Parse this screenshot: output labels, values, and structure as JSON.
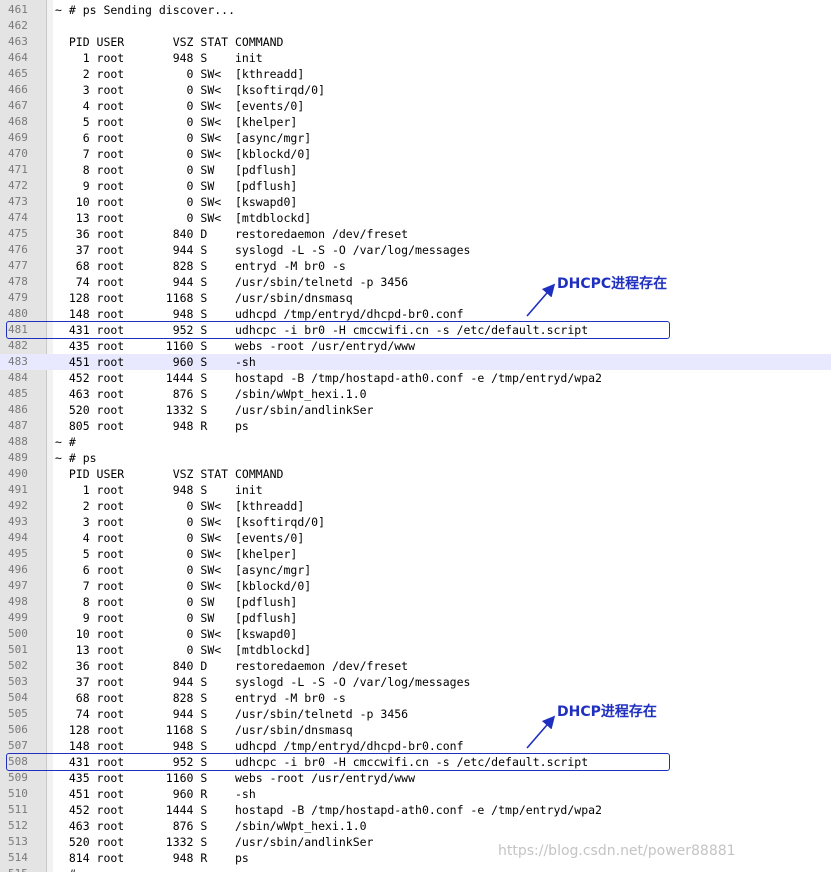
{
  "editor": {
    "lines": [
      {
        "n": "461",
        "text": "~ # ps Sending discover..."
      },
      {
        "n": "462",
        "text": ""
      },
      {
        "n": "463",
        "text": "  PID USER       VSZ STAT COMMAND"
      },
      {
        "n": "464",
        "text": "    1 root       948 S    init"
      },
      {
        "n": "465",
        "text": "    2 root         0 SW<  [kthreadd]"
      },
      {
        "n": "466",
        "text": "    3 root         0 SW<  [ksoftirqd/0]"
      },
      {
        "n": "467",
        "text": "    4 root         0 SW<  [events/0]"
      },
      {
        "n": "468",
        "text": "    5 root         0 SW<  [khelper]"
      },
      {
        "n": "469",
        "text": "    6 root         0 SW<  [async/mgr]"
      },
      {
        "n": "470",
        "text": "    7 root         0 SW<  [kblockd/0]"
      },
      {
        "n": "471",
        "text": "    8 root         0 SW   [pdflush]"
      },
      {
        "n": "472",
        "text": "    9 root         0 SW   [pdflush]"
      },
      {
        "n": "473",
        "text": "   10 root         0 SW<  [kswapd0]"
      },
      {
        "n": "474",
        "text": "   13 root         0 SW<  [mtdblockd]"
      },
      {
        "n": "475",
        "text": "   36 root       840 D    restoredaemon /dev/freset"
      },
      {
        "n": "476",
        "text": "   37 root       944 S    syslogd -L -S -O /var/log/messages"
      },
      {
        "n": "477",
        "text": "   68 root       828 S    entryd -M br0 -s"
      },
      {
        "n": "478",
        "text": "   74 root       944 S    /usr/sbin/telnetd -p 3456"
      },
      {
        "n": "479",
        "text": "  128 root      1168 S    /usr/sbin/dnsmasq"
      },
      {
        "n": "480",
        "text": "  148 root       948 S    udhcpd /tmp/entryd/dhcpd-br0.conf"
      },
      {
        "n": "481",
        "text": "  431 root       952 S    udhcpc -i br0 -H cmccwifi.cn -s /etc/default.script"
      },
      {
        "n": "482",
        "text": "  435 root      1160 S    webs -root /usr/entryd/www"
      },
      {
        "n": "483",
        "text": "  451 root       960 S    -sh"
      },
      {
        "n": "484",
        "text": "  452 root      1444 S    hostapd -B /tmp/hostapd-ath0.conf -e /tmp/entryd/wpa2"
      },
      {
        "n": "485",
        "text": "  463 root       876 S    /sbin/wWpt_hexi.1.0"
      },
      {
        "n": "486",
        "text": "  520 root      1332 S    /usr/sbin/andlinkSer"
      },
      {
        "n": "487",
        "text": "  805 root       948 R    ps"
      },
      {
        "n": "488",
        "text": "~ #"
      },
      {
        "n": "489",
        "text": "~ # ps"
      },
      {
        "n": "490",
        "text": "  PID USER       VSZ STAT COMMAND"
      },
      {
        "n": "491",
        "text": "    1 root       948 S    init"
      },
      {
        "n": "492",
        "text": "    2 root         0 SW<  [kthreadd]"
      },
      {
        "n": "493",
        "text": "    3 root         0 SW<  [ksoftirqd/0]"
      },
      {
        "n": "494",
        "text": "    4 root         0 SW<  [events/0]"
      },
      {
        "n": "495",
        "text": "    5 root         0 SW<  [khelper]"
      },
      {
        "n": "496",
        "text": "    6 root         0 SW<  [async/mgr]"
      },
      {
        "n": "497",
        "text": "    7 root         0 SW<  [kblockd/0]"
      },
      {
        "n": "498",
        "text": "    8 root         0 SW   [pdflush]"
      },
      {
        "n": "499",
        "text": "    9 root         0 SW   [pdflush]"
      },
      {
        "n": "500",
        "text": "   10 root         0 SW<  [kswapd0]"
      },
      {
        "n": "501",
        "text": "   13 root         0 SW<  [mtdblockd]"
      },
      {
        "n": "502",
        "text": "   36 root       840 D    restoredaemon /dev/freset"
      },
      {
        "n": "503",
        "text": "   37 root       944 S    syslogd -L -S -O /var/log/messages"
      },
      {
        "n": "504",
        "text": "   68 root       828 S    entryd -M br0 -s"
      },
      {
        "n": "505",
        "text": "   74 root       944 S    /usr/sbin/telnetd -p 3456"
      },
      {
        "n": "506",
        "text": "  128 root      1168 S    /usr/sbin/dnsmasq"
      },
      {
        "n": "507",
        "text": "  148 root       948 S    udhcpd /tmp/entryd/dhcpd-br0.conf"
      },
      {
        "n": "508",
        "text": "  431 root       952 S    udhcpc -i br0 -H cmccwifi.cn -s /etc/default.script"
      },
      {
        "n": "509",
        "text": "  435 root      1160 S    webs -root /usr/entryd/www"
      },
      {
        "n": "510",
        "text": "  451 root       960 R    -sh"
      },
      {
        "n": "511",
        "text": "  452 root      1444 S    hostapd -B /tmp/hostapd-ath0.conf -e /tmp/entryd/wpa2"
      },
      {
        "n": "512",
        "text": "  463 root       876 S    /sbin/wWpt_hexi.1.0"
      },
      {
        "n": "513",
        "text": "  520 root      1332 S    /usr/sbin/andlinkSer"
      },
      {
        "n": "514",
        "text": "  814 root       948 R    ps"
      },
      {
        "n": "515",
        "text": "~ #"
      }
    ],
    "highlighted_line": "483"
  },
  "annotations": {
    "first_label": "DHCPC进程存在",
    "second_label": "DHCP进程存在",
    "color": "#1f2fbf"
  },
  "watermark": "https://blog.csdn.net/power88881"
}
